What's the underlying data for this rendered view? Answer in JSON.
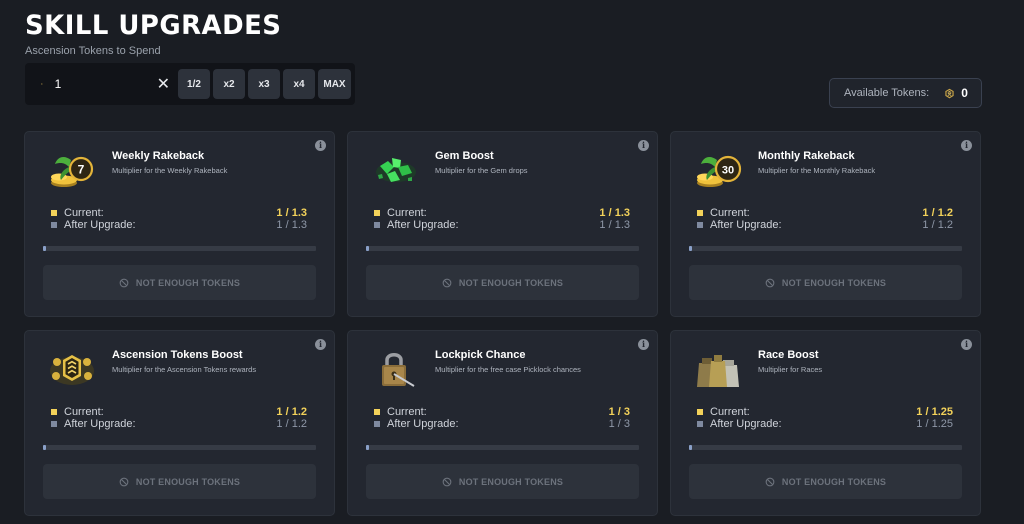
{
  "header": {
    "title": "SKILL UPGRADES",
    "subtitle": "Ascension Tokens to Spend"
  },
  "token_input": {
    "value": "1",
    "clear_label": "✕",
    "multipliers": [
      "1/2",
      "x2",
      "x3",
      "x4",
      "MAX"
    ]
  },
  "available": {
    "label": "Available Tokens:",
    "count": "0"
  },
  "labels": {
    "current": "Current:",
    "after": "After Upgrade:",
    "button": "NOT ENOUGH TOKENS"
  },
  "icons": {
    "token": "ascension-token-icon",
    "info": "info-icon",
    "disabled": "ban-icon"
  },
  "colors": {
    "current": "#f3d25a",
    "after": "#7f8aa0",
    "background": "#1a1d23",
    "card": "#232730"
  },
  "cards": [
    {
      "title": "Weekly Rakeback",
      "description": "Multiplier for the Weekly Rakeback",
      "current": "1 / 1.3",
      "after": "1 / 1.3",
      "progress": 0.01,
      "image": "weekly-rakeback-coins-image"
    },
    {
      "title": "Gem Boost",
      "description": "Multiplier for the Gem drops",
      "current": "1 / 1.3",
      "after": "1 / 1.3",
      "progress": 0.01,
      "image": "green-gems-image"
    },
    {
      "title": "Monthly Rakeback",
      "description": "Multiplier for the Monthly Rakeback",
      "current": "1 / 1.2",
      "after": "1 / 1.2",
      "progress": 0.01,
      "image": "monthly-rakeback-coins-image"
    },
    {
      "title": "Ascension Tokens Boost",
      "description": "Multiplier for the Ascension Tokens rewards",
      "current": "1 / 1.2",
      "after": "1 / 1.2",
      "progress": 0.01,
      "image": "ascension-tokens-image"
    },
    {
      "title": "Lockpick Chance",
      "description": "Multiplier for the free case Picklock chances",
      "current": "1 / 3",
      "after": "1 / 3",
      "progress": 0.01,
      "image": "padlock-lockpick-image"
    },
    {
      "title": "Race Boost",
      "description": "Multiplier for Races",
      "current": "1 / 1.25",
      "after": "1 / 1.25",
      "progress": 0.01,
      "image": "race-bags-image"
    }
  ]
}
